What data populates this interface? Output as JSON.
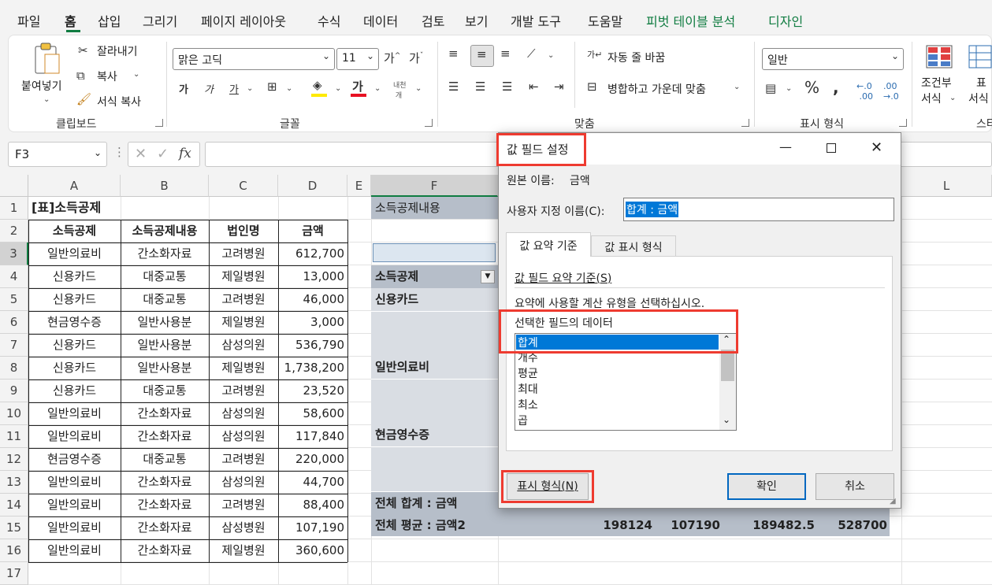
{
  "menu": [
    "파일",
    "홈",
    "삽입",
    "그리기",
    "페이지 레이아웃",
    "수식",
    "데이터",
    "검토",
    "보기",
    "개발 도구",
    "도움말",
    "피벗 테이블 분석",
    "디자인"
  ],
  "ribbon": {
    "paste": "붙여넣기",
    "cut": "잘라내기",
    "copy": "복사",
    "format_painter": "서식 복사",
    "font_name": "맑은 고딕",
    "font_size": "11",
    "wrap_text": "자동 줄 바꿈",
    "merge_center": "병합하고 가운데 맞춤",
    "number_format": "일반",
    "cond_format_1": "조건부",
    "cond_format_2": "서식",
    "table_format_1": "표",
    "table_format_2": "서식",
    "groups": {
      "clipboard": "클립보드",
      "font": "글꼴",
      "alignment": "맞춤",
      "number": "표시 형식",
      "styles": "스타"
    }
  },
  "formula_bar": {
    "name_box": "F3",
    "fx": "fx",
    "formula": ""
  },
  "columns": [
    "A",
    "B",
    "C",
    "D",
    "E",
    "F",
    "L"
  ],
  "rows": [
    "1",
    "2",
    "3",
    "4",
    "5",
    "6",
    "7",
    "8",
    "9",
    "10",
    "11",
    "12",
    "13",
    "14",
    "15",
    "16",
    "17"
  ],
  "table": {
    "title": "[표]소득공제",
    "headers": [
      "소득공제",
      "소득공제내용",
      "법인명",
      "금액"
    ],
    "rows": [
      [
        "일반의료비",
        "간소화자료",
        "고려병원",
        "612,700"
      ],
      [
        "신용카드",
        "대중교통",
        "제일병원",
        "13,000"
      ],
      [
        "신용카드",
        "대중교통",
        "고려병원",
        "46,000"
      ],
      [
        "현금영수증",
        "일반사용분",
        "제일병원",
        "3,000"
      ],
      [
        "신용카드",
        "일반사용분",
        "삼성의원",
        "536,790"
      ],
      [
        "신용카드",
        "일반사용분",
        "제일병원",
        "1,738,200"
      ],
      [
        "신용카드",
        "대중교통",
        "고려병원",
        "23,520"
      ],
      [
        "일반의료비",
        "간소화자료",
        "삼성의원",
        "58,600"
      ],
      [
        "일반의료비",
        "간소화자료",
        "삼성의원",
        "117,840"
      ],
      [
        "현금영수증",
        "대중교통",
        "고려병원",
        "220,000"
      ],
      [
        "일반의료비",
        "간소화자료",
        "삼성의원",
        "44,700"
      ],
      [
        "일반의료비",
        "간소화자료",
        "고려병원",
        "88,400"
      ],
      [
        "일반의료비",
        "간소화자료",
        "삼성병원",
        "107,190"
      ],
      [
        "일반의료비",
        "간소화자료",
        "제일병원",
        "360,600"
      ]
    ]
  },
  "pivot": {
    "filter_label": "소득공제내용",
    "row_field": "소득공제",
    "items": [
      "신용카드",
      "일반의료비",
      "현금영수증"
    ],
    "total_sum_label": "전체 합계 : 금액",
    "total_avg_label": "전체 평균 : 금액2",
    "avg_values": [
      "198124",
      "107190",
      "189482.5",
      "528700"
    ]
  },
  "dialog": {
    "title": "값 필드 설정",
    "source_label": "원본 이름:",
    "source_value": "금액",
    "custom_label": "사용자 지정 이름(C):",
    "custom_value": "합계 : 금액",
    "tabs": [
      "값 요약 기준",
      "값 표시 형식"
    ],
    "summarize_label": "값 필드 요약 기준(S)",
    "instruction": "요약에 사용할 계산 유형을 선택하십시오.",
    "data_label": "선택한 필드의 데이터",
    "functions": [
      "합계",
      "개수",
      "평균",
      "최대",
      "최소",
      "곱"
    ],
    "number_format_btn": "표시 형식(N)",
    "ok": "확인",
    "cancel": "취소"
  },
  "colors": {
    "accent": "#107c41",
    "highlight": "#ee3b30",
    "selection": "#0078d7"
  }
}
